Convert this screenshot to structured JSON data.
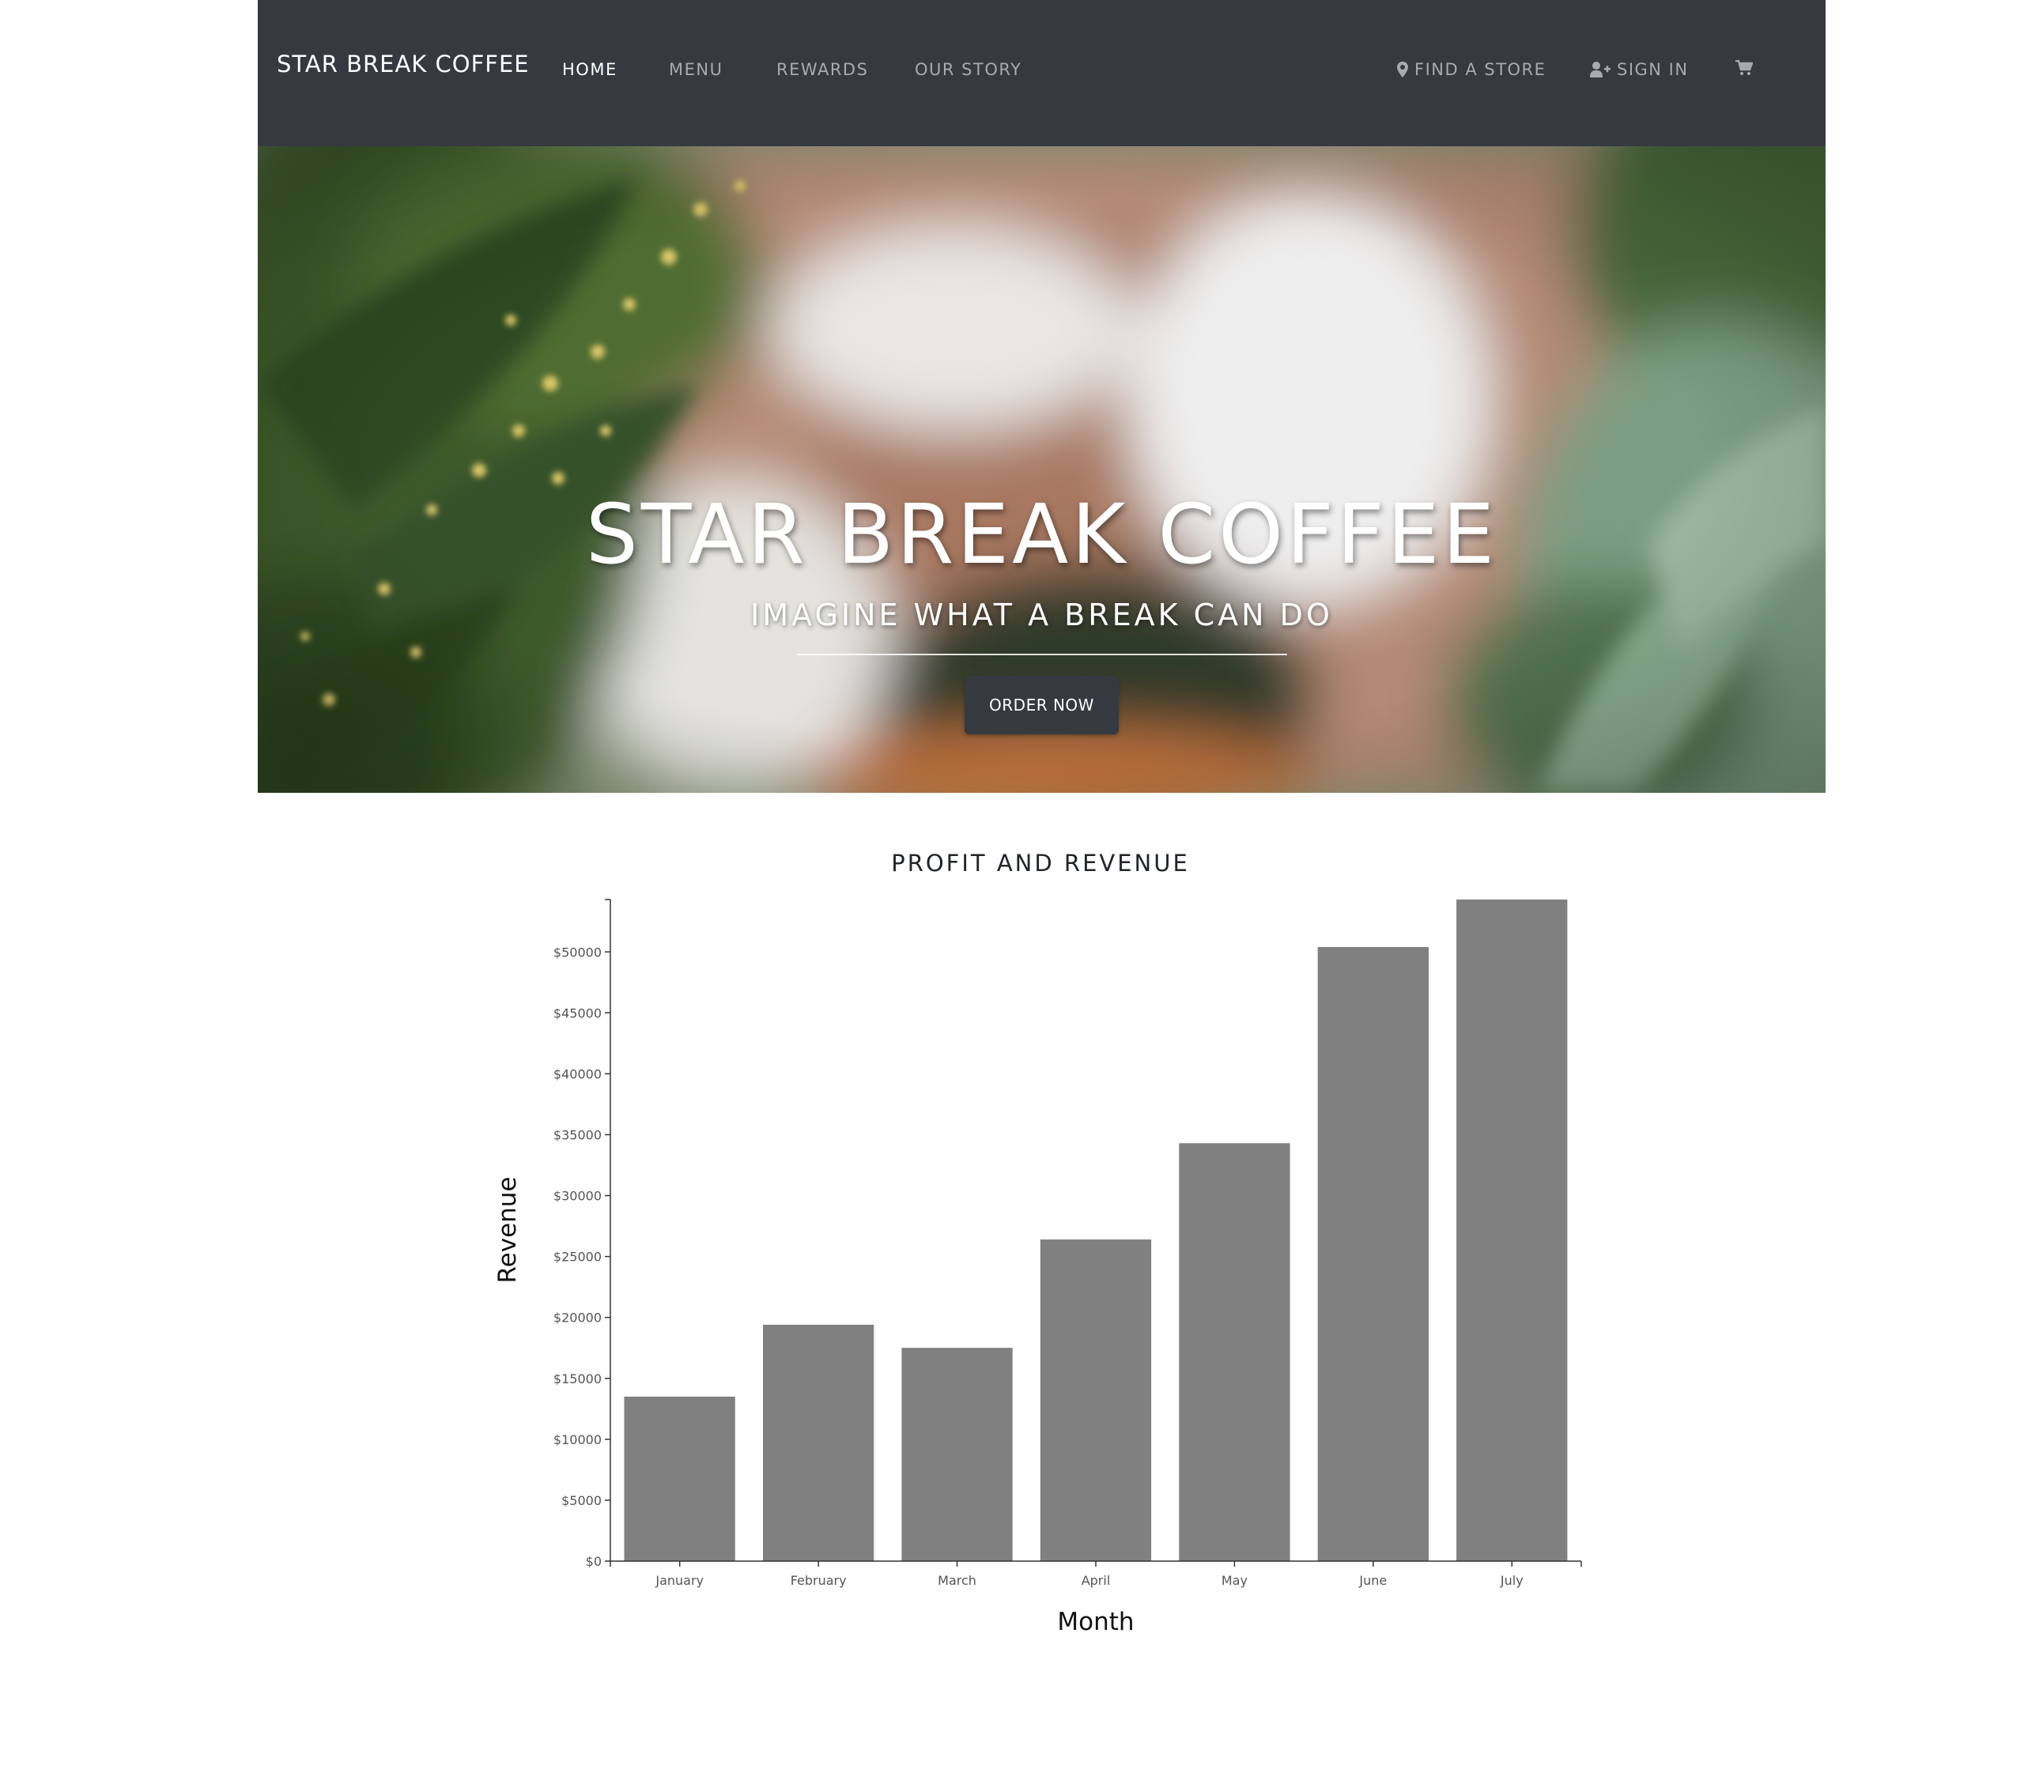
{
  "navbar": {
    "brand": "STAR BREAK COFFEE",
    "links": [
      {
        "label": "HOME",
        "active": true
      },
      {
        "label": "MENU",
        "active": false
      },
      {
        "label": "REWARDS",
        "active": false
      },
      {
        "label": "OUR STORY",
        "active": false
      }
    ],
    "find_store": {
      "label": "FIND A STORE",
      "icon": "map-marker-icon"
    },
    "sign_in": {
      "label": "SIGN IN",
      "icon": "user-plus-icon"
    },
    "cart": {
      "icon": "shopping-cart-icon"
    },
    "background_color": "#343a40"
  },
  "hero": {
    "title": "STAR BREAK COFFEE",
    "subtitle": "IMAGINE WHAT A BREAK CAN DO",
    "button_label": "ORDER NOW",
    "image_description": "blurred photo of coffee cup surrounded by green plants"
  },
  "chart_data": {
    "type": "bar",
    "title": "PROFIT AND REVENUE",
    "xlabel": "Month",
    "ylabel": "Revenue",
    "categories": [
      "January",
      "February",
      "March",
      "April",
      "May",
      "June",
      "July"
    ],
    "values": [
      13500,
      19400,
      17500,
      26400,
      34300,
      50400,
      54300
    ],
    "ylim": [
      0,
      54300
    ],
    "yticks": [
      0,
      5000,
      10000,
      15000,
      20000,
      25000,
      30000,
      35000,
      40000,
      45000,
      50000
    ],
    "ytick_labels": [
      "$0",
      "$5000",
      "$10000",
      "$15000",
      "$20000",
      "$25000",
      "$30000",
      "$35000",
      "$40000",
      "$45000",
      "$50000"
    ],
    "bar_color": "#808080",
    "grid": false,
    "legend": "none"
  }
}
